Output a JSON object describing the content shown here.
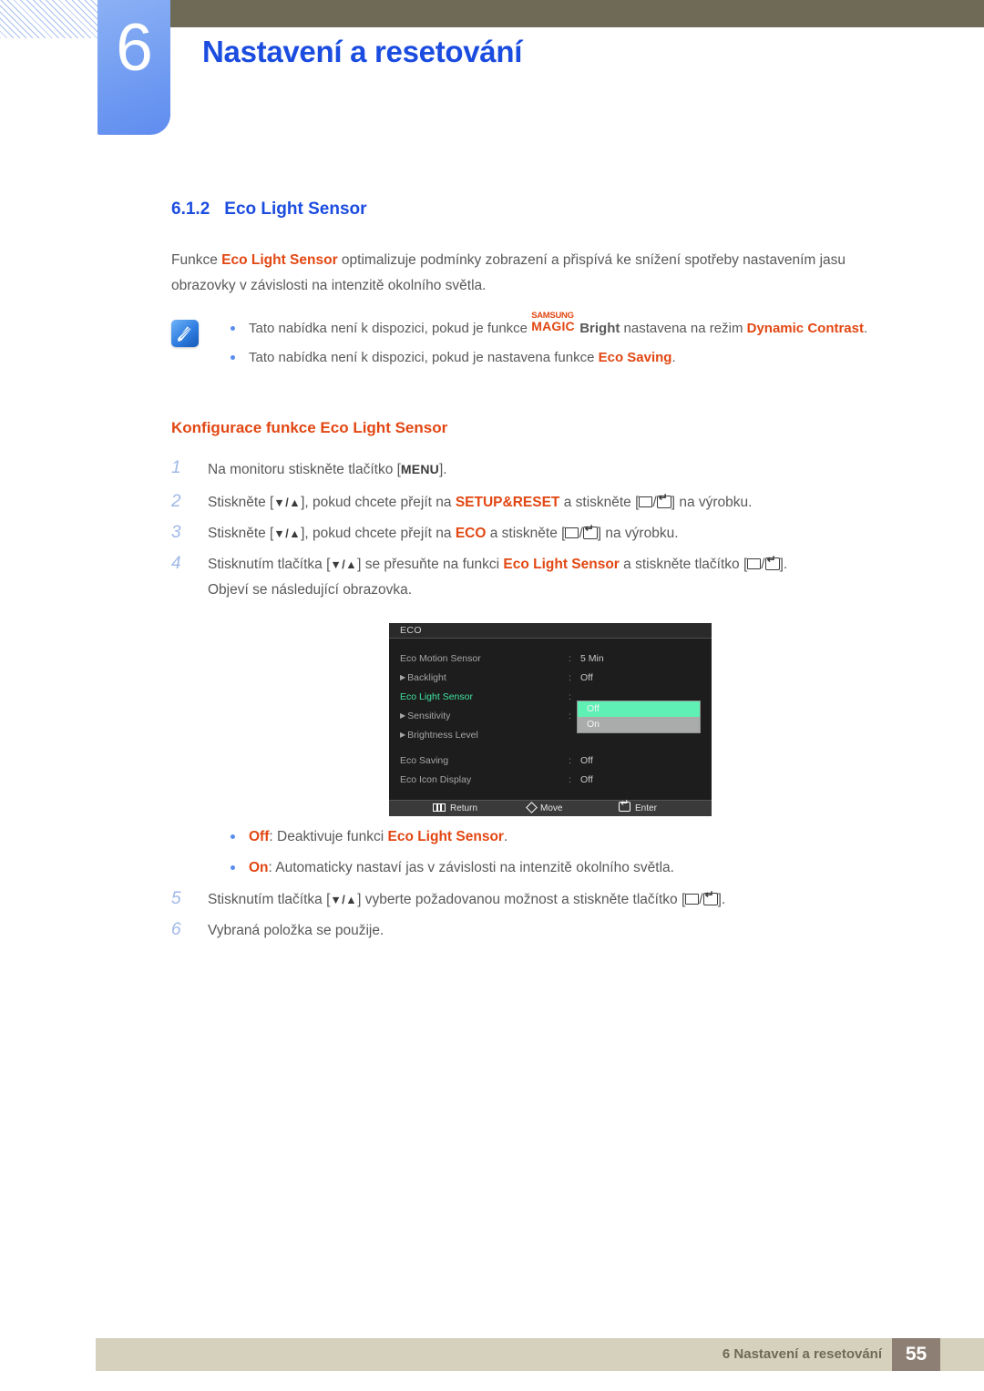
{
  "header": {
    "chapter_number": "6",
    "chapter_title": "Nastavení a resetování",
    "bar_color": "#6f6a56",
    "tab_color": "#6f9bf2",
    "title_color": "#1b4ce0"
  },
  "section": {
    "number": "6.1.2",
    "title": "Eco Light Sensor",
    "intro_pre": "Funkce ",
    "intro_highlight": "Eco Light Sensor",
    "intro_post": " optimalizuje podmínky zobrazení a přispívá ke snížení spotřeby nastavením jasu obrazovky v závislosti na intenzitě okolního světla."
  },
  "note": {
    "icon": "note-pen-icon",
    "items": [
      {
        "pre": "Tato nabídka není k dispozici, pokud je funkce ",
        "logo_samsung": "SAMSUNG",
        "logo_magic": "MAGIC",
        "logo_bright": "Bright",
        "mid": " nastavena na režim ",
        "highlight": "Dynamic Contrast",
        "post": "."
      },
      {
        "pre": "Tato nabídka není k dispozici, pokud je nastavena funkce ",
        "highlight": "Eco Saving",
        "post": "."
      }
    ]
  },
  "subhead": "Konfigurace funkce Eco Light Sensor",
  "steps": [
    {
      "number": "1",
      "pre": "Na monitoru stiskněte tlačítko [",
      "key": "MENU",
      "post": "]."
    },
    {
      "number": "2",
      "pre": "Stiskněte [",
      "arrows": "▼/▲",
      "mid": "], pokud chcete přejít na ",
      "highlight": "SETUP&RESET",
      "mid2": " a stiskněte [",
      "post": "] na výrobku."
    },
    {
      "number": "3",
      "pre": "Stiskněte [",
      "arrows": "▼/▲",
      "mid": "], pokud chcete přejít na ",
      "highlight": "ECO",
      "mid2": " a stiskněte [",
      "post": "] na výrobku."
    },
    {
      "number": "4",
      "pre": "Stisknutím tlačítka [",
      "arrows": "▼/▲",
      "mid": "] se přesuňte na funkci ",
      "highlight": "Eco Light Sensor",
      "mid2": " a stiskněte tlačítko [",
      "post": "].",
      "extra": "Objeví se následující obrazovka."
    },
    {
      "number": "5",
      "pre": "Stisknutím tlačítka [",
      "arrows": "▼/▲",
      "mid": "] vyberte požadovanou možnost a stiskněte tlačítko [",
      "post": "]."
    },
    {
      "number": "6",
      "pre": "Vybraná položka se použije."
    }
  ],
  "osd": {
    "title": "ECO",
    "selected_green": "#3fe0a0",
    "highlight_green": "#5ff0b5",
    "rows": [
      {
        "label": "Eco Motion Sensor",
        "submenu": false,
        "colon": ":",
        "value": "5 Min",
        "selected": false
      },
      {
        "label": "Backlight",
        "submenu": true,
        "colon": ":",
        "value": "Off",
        "selected": false
      },
      {
        "label": "Eco Light Sensor",
        "submenu": false,
        "colon": ":",
        "value": "",
        "selected": true
      },
      {
        "label": "Sensitivity",
        "submenu": true,
        "colon": ":",
        "value": "",
        "selected": false
      },
      {
        "label": "Brightness Level",
        "submenu": true,
        "colon": "",
        "value": "",
        "selected": false
      },
      {
        "label": "Eco Saving",
        "submenu": false,
        "colon": ":",
        "value": "Off",
        "selected": false
      },
      {
        "label": "Eco Icon Display",
        "submenu": false,
        "colon": ":",
        "value": "Off",
        "selected": false
      }
    ],
    "dropdown": {
      "options": [
        "Off",
        "On"
      ],
      "active_index": 0
    },
    "footer": [
      {
        "icon": "menu-bars-icon",
        "label": "Return"
      },
      {
        "icon": "diamond-move-icon",
        "label": "Move"
      },
      {
        "icon": "enter-icon",
        "label": "Enter"
      }
    ]
  },
  "options": [
    {
      "name": "Off",
      "pre": ": Deaktivuje funkci ",
      "highlight": "Eco Light Sensor",
      "post": "."
    },
    {
      "name": "On",
      "pre": ": Automaticky nastaví jas v závislosti na intenzitě okolního světla.",
      "highlight": "",
      "post": ""
    }
  ],
  "footer": {
    "text": "6 Nastavení a resetování",
    "page": "55",
    "bar_color": "#d6d1bd",
    "page_color": "#8d7f73"
  }
}
